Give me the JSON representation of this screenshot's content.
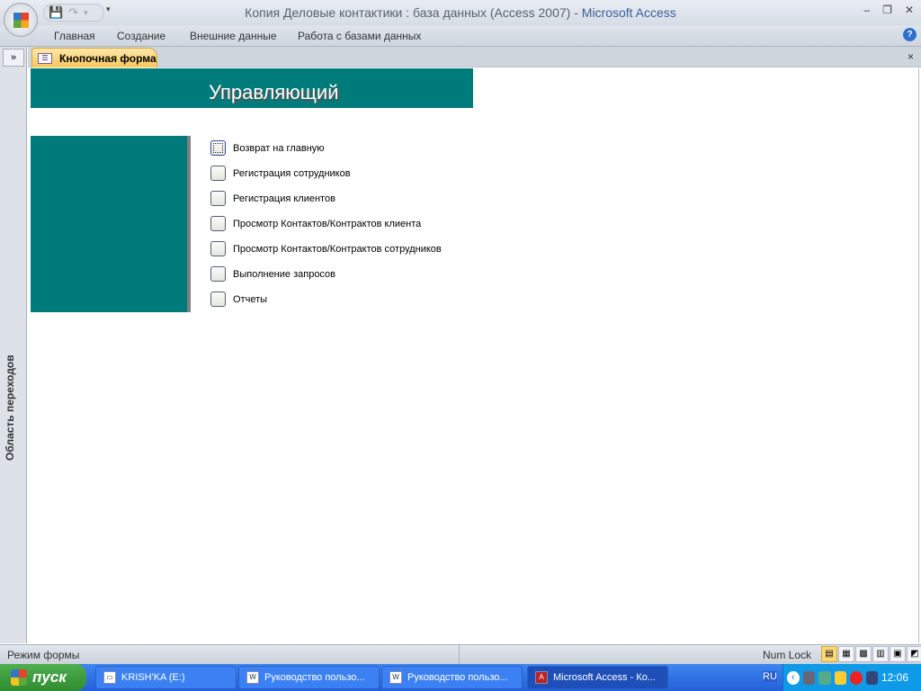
{
  "window": {
    "title_doc": "Копия Деловые контактики : база данных (Access 2007)",
    "title_sep": " - ",
    "title_app": "Microsoft Access"
  },
  "ribbon": {
    "tabs": [
      "Главная",
      "Создание",
      "Внешние данные",
      "Работа с базами данных"
    ],
    "help": "?"
  },
  "nav": {
    "toggle": "»",
    "label": "Область переходов"
  },
  "doc_tab": {
    "label": "Кнопочная форма",
    "close": "×"
  },
  "form": {
    "title": "Управляющий",
    "items": [
      "Возврат на главную",
      "Регистрация сотрудников",
      "Регистрация клиентов",
      "Просмотр Контактов/Контрактов клиента",
      "Просмотр Контактов/Контрактов сотрудников",
      "Выполнение запросов",
      "Отчеты"
    ]
  },
  "status": {
    "mode": "Режим формы",
    "numlock": "Num Lock"
  },
  "taskbar": {
    "start": "пуск",
    "tasks": [
      "KRISH'KA (E:)",
      "Руководство пользо...",
      "Руководство пользо...",
      "Microsoft Access - Ко..."
    ],
    "lang": "RU",
    "clock": "12:06"
  },
  "colors": {
    "teal": "#007b7b",
    "tab": "#f8c65c",
    "taskbar": "#2460d8"
  }
}
